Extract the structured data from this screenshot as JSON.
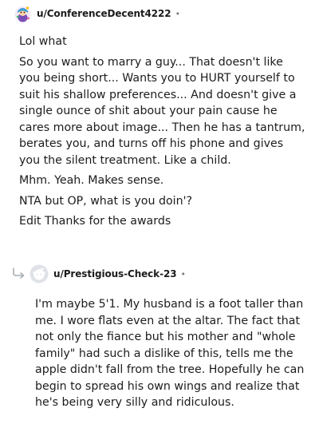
{
  "comment": {
    "username": "u/ConferenceDecent4222",
    "separator": "•",
    "avatar_icon": "snoo-avatar-icon",
    "paragraphs": [
      "Lol what",
      "So you want to marry a guy... That doesn't like you being short... Wants you to HURT yourself to suit his shallow preferences... And doesn't give a single ounce of shit about your pain cause he cares more about image... Then he has a tantrum, berates you, and turns off his phone and gives you the silent treatment. Like a child.",
      "Mhm. Yeah. Makes sense.",
      "NTA but OP, what is you doin'?",
      "Edit Thanks for the awards"
    ]
  },
  "reply": {
    "reply_icon": "reply-arrow-icon",
    "avatar_icon": "default-avatar-icon",
    "username": "u/Prestigious-Check-23",
    "separator": "•",
    "paragraphs": [
      "I'm maybe 5'1. My husband is a foot taller than me. I wore flats even at the altar. The fact that not only the fiance but his mother and \"whole family\" had such a dislike of this, tells me the apple didn't fall from the tree. Hopefully he can begin to spread his own wings and realize that he's being very silly and ridiculous."
    ]
  },
  "colors": {
    "text": "#1c1c1c",
    "meta": "#7c7c7c",
    "avatar_bg": "#dfe3e8"
  }
}
